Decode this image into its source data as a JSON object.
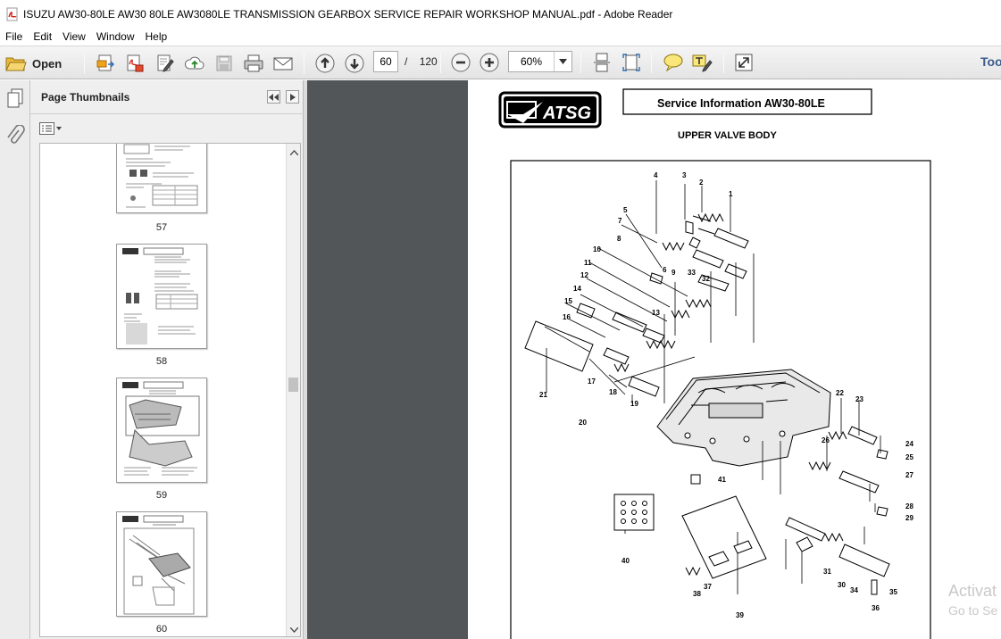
{
  "window": {
    "title": "ISUZU AW30-80LE  AW30 80LE AW3080LE  TRANSMISSION GEARBOX SERVICE  REPAIR   WORKSHOP MANUAL.pdf - Adobe Reader",
    "icon": "pdf-file-icon"
  },
  "menu": [
    "File",
    "Edit",
    "View",
    "Window",
    "Help"
  ],
  "toolbar": {
    "open_label": "Open",
    "current_page": "60",
    "page_separator": "/",
    "total_pages": "120",
    "zoom": "60%",
    "tools_label": "Tools",
    "icons": [
      "open-folder-icon",
      "create-pdf-icon",
      "export-pdf-icon",
      "edit-pdf-icon",
      "upload-cloud-icon",
      "save-icon",
      "print-icon",
      "email-icon",
      "prev-page-icon",
      "next-page-icon",
      "zoom-out-icon",
      "zoom-in-icon",
      "scroll-mode-icon",
      "fit-page-icon",
      "comment-icon",
      "sign-icon",
      "fullscreen-icon"
    ]
  },
  "sidebar": {
    "tools": [
      "pages-icon",
      "attachment-icon"
    ]
  },
  "thumbnails_panel": {
    "title": "Page Thumbnails",
    "pages": [
      {
        "label": "57"
      },
      {
        "label": "58"
      },
      {
        "label": "59"
      },
      {
        "label": "60"
      }
    ]
  },
  "document_page": {
    "logo_text": "ATSG",
    "header": "Service Information   AW30-80LE",
    "subtitle": "UPPER VALVE BODY",
    "callouts": [
      "1",
      "2",
      "3",
      "4",
      "5",
      "6",
      "7",
      "8",
      "9",
      "10",
      "11",
      "12",
      "13",
      "14",
      "15",
      "16",
      "17",
      "18",
      "19",
      "20",
      "21",
      "22",
      "23",
      "24",
      "25",
      "26",
      "27",
      "28",
      "29",
      "30",
      "31",
      "32",
      "33",
      "34",
      "35",
      "36",
      "37",
      "38",
      "39",
      "40",
      "41"
    ]
  },
  "overlay": {
    "line1": "Activat",
    "line2": "Go to Se"
  },
  "colors": {
    "doc_background": "#525659",
    "panel_background": "#efefef",
    "tools_accent": "#3d5b8c"
  }
}
